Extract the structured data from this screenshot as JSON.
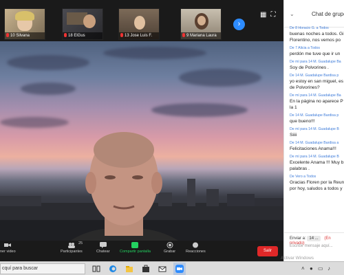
{
  "participants_strip": {
    "thumbs": [
      {
        "label": "10 Silvana"
      },
      {
        "label": "18 ElGus"
      },
      {
        "label": "13 Jose Luis F."
      },
      {
        "label": "9 Mariana Laura"
      }
    ],
    "next_icon": "chevron-right-icon"
  },
  "toolbar": {
    "video_label": "ner video",
    "participants_label": "Participantes",
    "participants_count": "25",
    "chat_label": "Chatear",
    "share_label": "Compartir pantalla",
    "record_label": "Grabar",
    "reactions_label": "Reacciones",
    "leave_label": "Salir"
  },
  "chat": {
    "title": "Chat de grupo",
    "messages": [
      {
        "from": "De 8 Horacio G. a Todos",
        "lines": [
          "buenas noches a todos. Gi",
          "Florentino, nos vemos po"
        ]
      },
      {
        "from": "De 7 Alicia a Todos",
        "lines": [
          "perdón me tuve que ir un"
        ]
      },
      {
        "from": "De mí para 14 M. Guadalupe Ba",
        "lines": [
          "Soy de Polvorines ."
        ]
      },
      {
        "from": "De 14 M. Guadalupe Bardisa p",
        "lines": [
          "yo estoy en san miguel, es",
          "de Polvorines?"
        ]
      },
      {
        "from": "De mí para 14 M. Guadalupe Ba",
        "lines": [
          "En la página no aparece P",
          "la 1"
        ]
      },
      {
        "from": "De 14 M. Guadalupe Bardisa p",
        "lines": [
          "que bueno!!!"
        ]
      },
      {
        "from": "De mí para 14 M. Guadalupe B",
        "lines": [
          "Siiii"
        ]
      },
      {
        "from": "De 14 M. Guadalupe Bardisa a",
        "lines": [
          "Felicitaciones Anama!!!"
        ]
      },
      {
        "from": "De mí para 14 M. Guadalupe B",
        "lines": [
          "Excelente Anama !!! Muy b",
          "palabras ."
        ]
      },
      {
        "from": "De Vero a Todos",
        "lines": [
          "Gracias Floren por la Reun",
          "por hoy, saludos a todos y"
        ]
      }
    ],
    "to_label": "Enviar a:",
    "to_value": "14 ...",
    "private_label": "(En privado)",
    "input_placeholder": "Escribir mensaje aquí..."
  },
  "taskbar": {
    "search_text": "cquí para buscar"
  },
  "watermark": "Activar Windows"
}
